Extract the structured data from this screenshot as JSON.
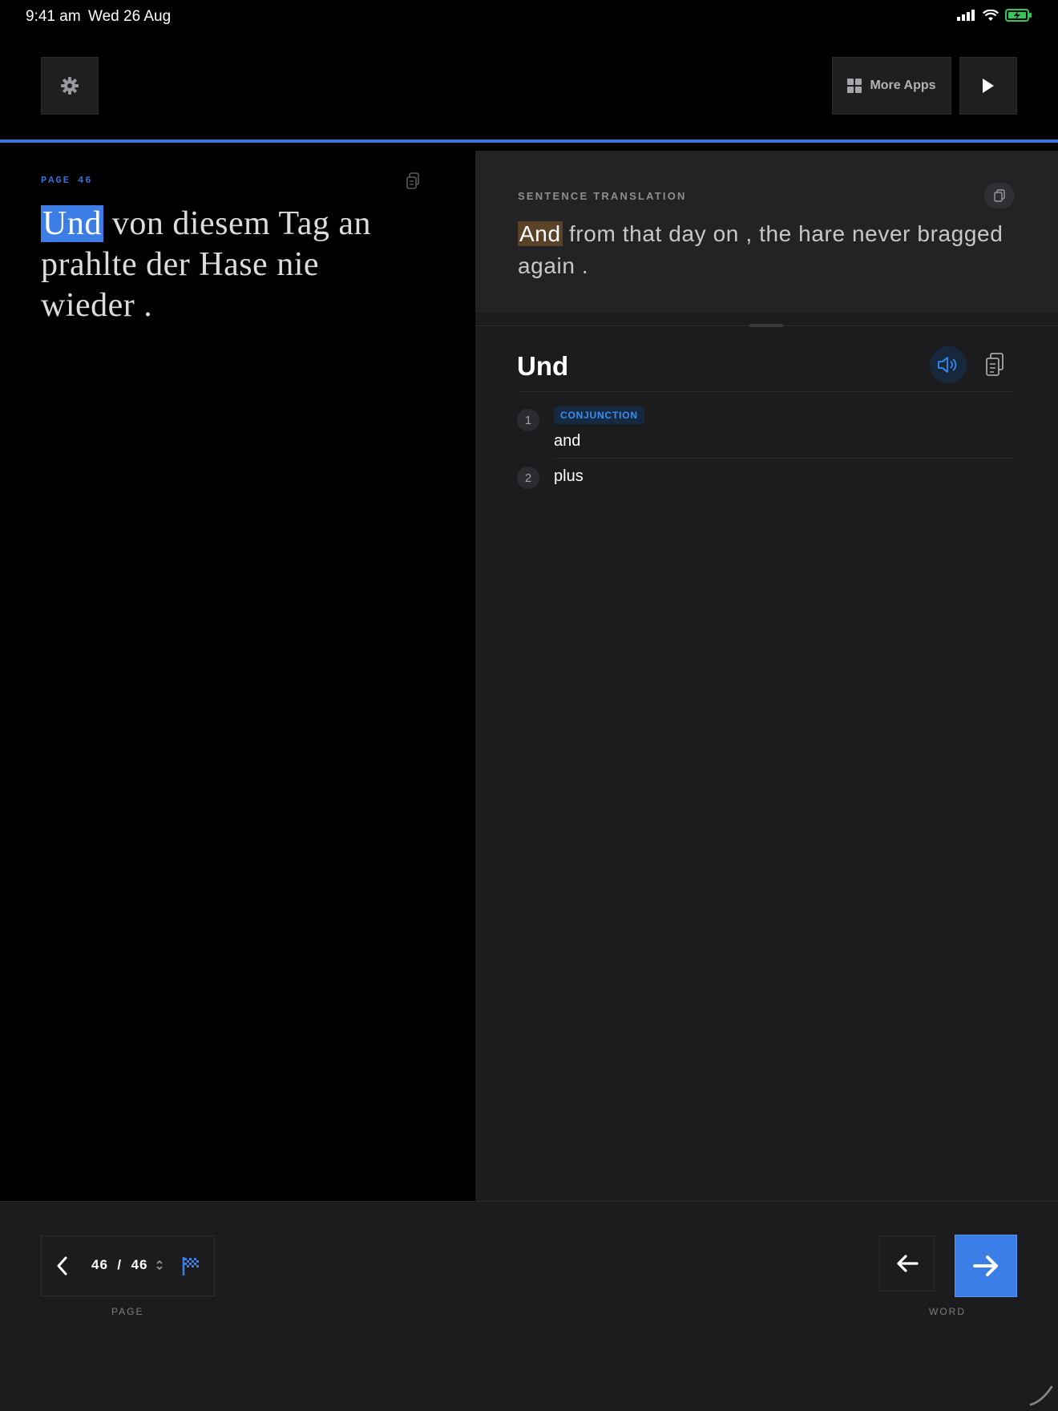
{
  "status_bar": {
    "time": "9:41 am",
    "date": "Wed 26 Aug",
    "battery_color": "#34c759"
  },
  "toolbar": {
    "settings_icon": "gear-icon",
    "more_apps_label": "More Apps",
    "play_icon": "play-icon",
    "accent_color": "#3b7ae3"
  },
  "reader": {
    "page_label": "PAGE 46",
    "highlighted_word": "Und",
    "sentence_rest_line1": " von diesem Tag an",
    "sentence_line2": "prahlte der Hase nie",
    "sentence_line3": "wieder",
    "sentence_end": " ."
  },
  "translation": {
    "label": "SENTENCE TRANSLATION",
    "highlighted_word": "And",
    "text_rest_line1": " from that day on , the hare never bragged",
    "text_line2": "again ."
  },
  "dictionary": {
    "word": "Und",
    "senses": [
      {
        "number": "1",
        "part_of_speech": "CONJUNCTION",
        "meaning": "and"
      },
      {
        "number": "2",
        "meaning": "plus"
      }
    ]
  },
  "bottom": {
    "page_current": "46",
    "page_separator": "/",
    "page_total": "46",
    "page_label": "PAGE",
    "word_label": "WORD"
  }
}
